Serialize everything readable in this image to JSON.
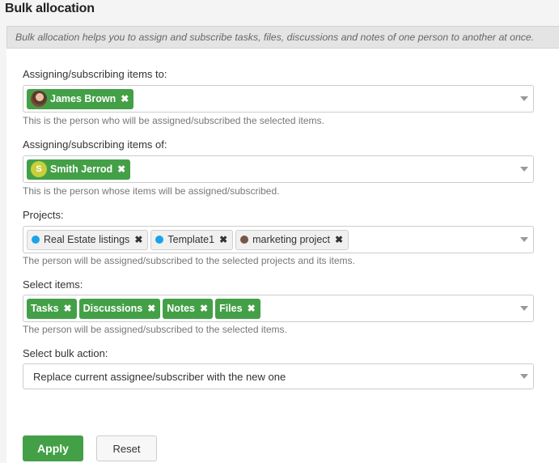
{
  "header": {
    "title": "Bulk allocation",
    "info": "Bulk allocation helps you to assign and subscribe tasks, files, discussions and notes of one person to another at once."
  },
  "fields": {
    "assign_to": {
      "label": "Assigning/subscribing items to:",
      "selected": [
        {
          "name": "James Brown",
          "avatar": "photo"
        }
      ],
      "help": "This is the person who will be assigned/subscribed the selected items."
    },
    "assign_of": {
      "label": "Assigning/subscribing items of:",
      "selected": [
        {
          "name": "Smith Jerrod",
          "avatar_letter": "S",
          "avatar_color": "#c8cf3a"
        }
      ],
      "help": "This is the person whose items will be assigned/subscribed."
    },
    "projects": {
      "label": "Projects:",
      "selected": [
        {
          "name": "Real Estate listings",
          "color": "#1aa3e8"
        },
        {
          "name": "Template1",
          "color": "#1aa3e8"
        },
        {
          "name": "marketing project",
          "color": "#795548"
        }
      ],
      "help": "The person will be assigned/subscribed to the selected projects and its items."
    },
    "items": {
      "label": "Select items:",
      "selected": [
        "Tasks",
        "Discussions",
        "Notes",
        "Files"
      ],
      "help": "The person will be assigned/subscribed to the selected items."
    },
    "bulk_action": {
      "label": "Select bulk action:",
      "value": "Replace current assignee/subscriber with the new one"
    }
  },
  "buttons": {
    "apply": "Apply",
    "reset": "Reset"
  },
  "icons": {
    "remove": "✖"
  },
  "colors": {
    "accent_green": "#43a047"
  }
}
